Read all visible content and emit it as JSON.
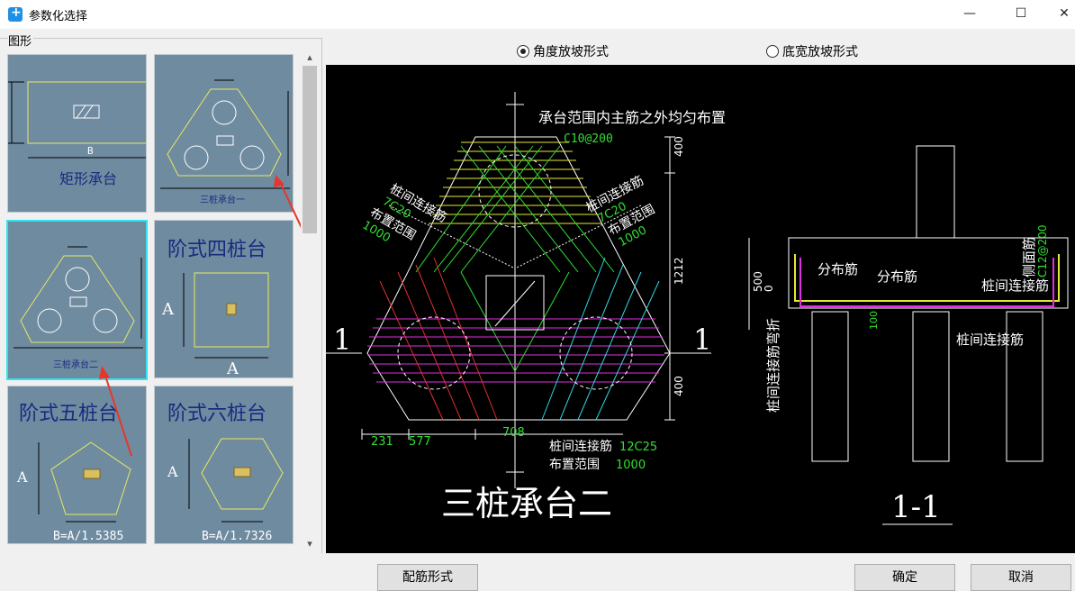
{
  "window": {
    "title": "参数化选择",
    "minimize_glyph": "—",
    "maximize_glyph": "☐",
    "close_glyph": "✕"
  },
  "sidebar": {
    "group_label": "图形",
    "items": [
      {
        "label": "矩形承台",
        "dim": "B"
      },
      {
        "label": "三桩承台一"
      },
      {
        "label": "三桩承台二",
        "selected": true
      },
      {
        "label": "阶式四桩台",
        "dim_a": "A",
        "dim_b": "A"
      },
      {
        "label": "阶式五桩台",
        "dim_a": "A",
        "formula": "B=A/1.5385"
      },
      {
        "label": "阶式六桩台",
        "dim_a": "A",
        "formula": "B=A/1.7326"
      }
    ]
  },
  "radio_options": [
    {
      "label": "角度放坡形式",
      "checked": true
    },
    {
      "label": "底宽放坡形式",
      "checked": false
    }
  ],
  "drawing": {
    "note_top": "承台范围内主筋之外均匀布置",
    "rebar_top": "C10@200",
    "left_tie_label": "桩间连接筋",
    "left_tie_rebar": "7C20",
    "left_range_label": "布置范围",
    "left_range_value": "1000",
    "right_tie_label": "桩间连接筋",
    "right_tie_rebar": "7C20",
    "right_range_label": "布置范围",
    "right_range_value": "1000",
    "dim_400_top": "400",
    "dim_1212": "1212",
    "dim_400_bottom": "400",
    "dim_231": "231",
    "dim_577": "577",
    "dim_708": "708",
    "bottom_tie_label": "桩间连接筋",
    "bottom_tie_rebar": "12C25",
    "bottom_range_label": "布置范围",
    "bottom_range_value": "1000",
    "section_mark_left": "1",
    "section_mark_right": "1",
    "plan_title": "三桩承台二",
    "section_title": "1-1",
    "sec_dist_1": "分布筋",
    "sec_dist_2": "分布筋",
    "sec_tie_top": "桩间连接筋",
    "sec_tie_bottom": "桩间连接筋",
    "sec_tie_vertical": "桩间连接筋弯折",
    "sec_side_label": "侧面筋",
    "sec_side_rebar": "C12@200",
    "sec_dim_500": "500",
    "sec_dim_0": "0",
    "sec_dim_100": "100"
  },
  "footer": {
    "rebar_form_button": "配筋形式",
    "ok_button": "确定",
    "cancel_button": "取消"
  }
}
